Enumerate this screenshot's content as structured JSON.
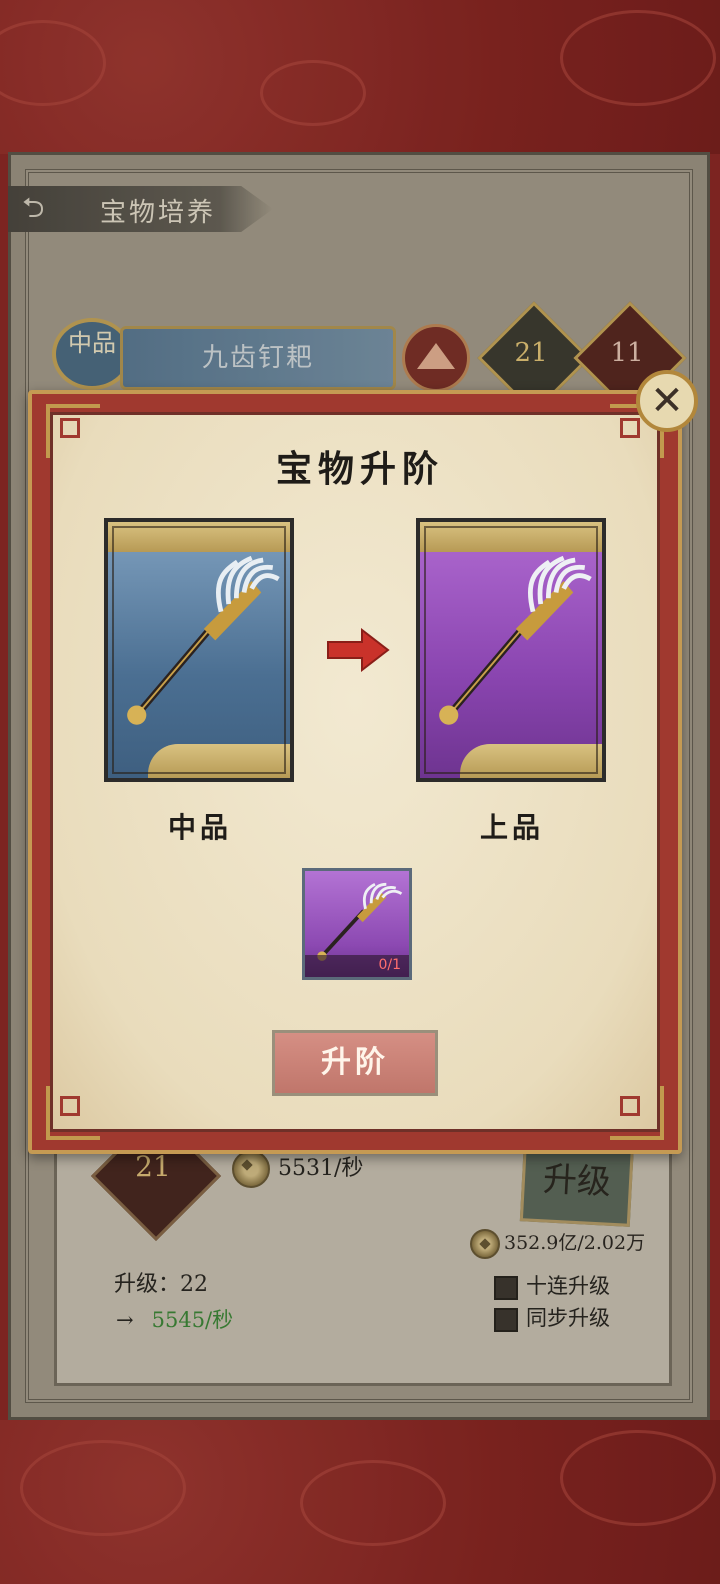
{
  "stage": {
    "title": "宝物培养",
    "grade_badge": "中品",
    "treasure_name": "九齿钉耙",
    "stat_a": "21",
    "stat_b": "11"
  },
  "lower": {
    "level_diamond": "21",
    "rate": "5531/秒",
    "upgrade_seal": "升级",
    "cost": "352.9亿/2.02万",
    "level_label": "升级：22",
    "next_arrow": "→",
    "next_rate": "5545/秒",
    "option_ten": "十连升级",
    "option_sync": "同步升级"
  },
  "modal": {
    "title": "宝物升阶",
    "from_grade": "中品",
    "to_grade": "上品",
    "material_count": "0/1",
    "advance_label": "升阶",
    "close_symbol": "✕"
  },
  "colors": {
    "from_card": "#4b6f92",
    "to_card": "#8a45b0",
    "accent_gold": "#c59a53",
    "modal_red": "#a0392f",
    "next_rate_green": "#3f8a39",
    "count_red": "#ff6e6e"
  }
}
